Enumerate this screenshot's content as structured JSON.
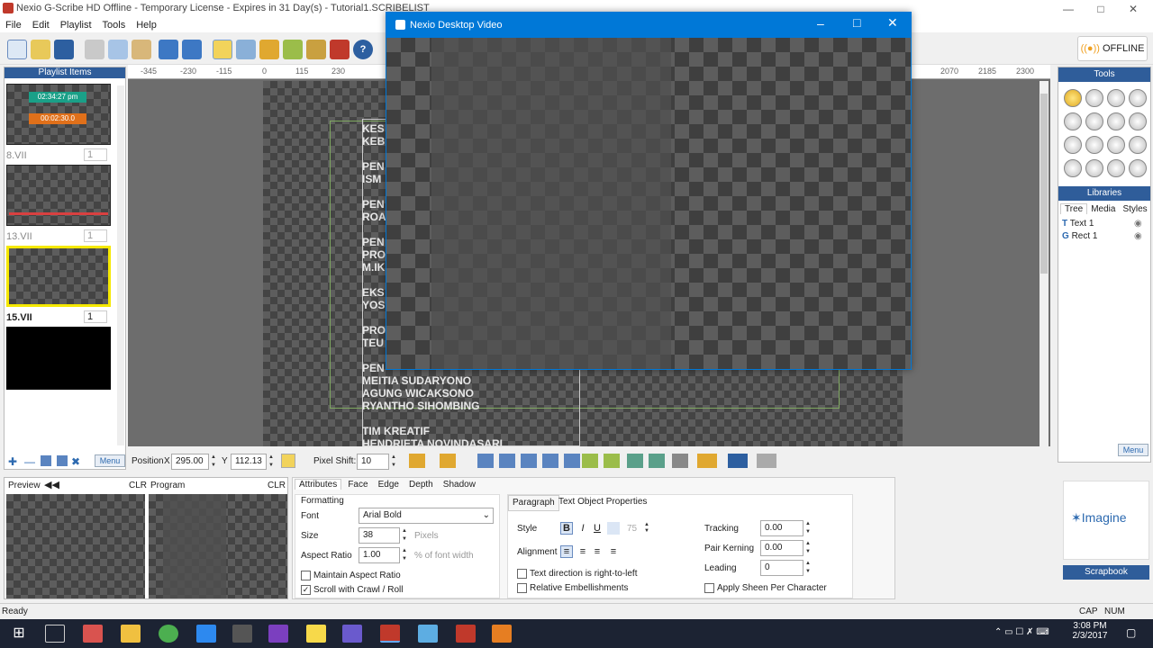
{
  "window": {
    "title": "Nexio G-Scribe HD Offline - Temporary License - Expires in 31 Day(s) - Tutorial1.SCRIBELIST"
  },
  "menu": [
    "File",
    "Edit",
    "Playlist",
    "Tools",
    "Help"
  ],
  "offline_label": "OFFLINE",
  "playlist": {
    "header": "Playlist Items",
    "items": [
      {
        "name": "8.VII",
        "count": "1",
        "time1": "02:34:27 pm",
        "time2": "00:02:30.0"
      },
      {
        "name": "13.VII",
        "count": "1"
      },
      {
        "name": "15.VII",
        "count": "1"
      }
    ],
    "menu_label": "Menu"
  },
  "ruler_ticks": [
    "-345",
    "-230",
    "-115",
    "0",
    "115",
    "230",
    "2070",
    "2185",
    "2300"
  ],
  "canvas_text": [
    "KES",
    "KEB",
    "PEN",
    "ISM",
    "PEN",
    "ROA",
    "PEN",
    "PRO",
    "M.IK",
    "EKS",
    "YOS",
    "PRO",
    "TEU",
    "PEN",
    "MEITIA SUDARYONO",
    "AGUNG WICAKSONO",
    "RYANTHO SIHOMBING",
    "TIM KREATIF",
    "HENDRIETA NOVINDASARI"
  ],
  "video_window": {
    "title": "Nexio Desktop Video"
  },
  "position": {
    "label": "Position",
    "x_label": "X",
    "x": "295.00",
    "y_label": "Y",
    "y": "112.13",
    "pixel_shift_label": "Pixel Shift:",
    "pixel_shift": "10"
  },
  "preview": {
    "preview_label": "Preview",
    "clr1": "CLR",
    "program_label": "Program",
    "clr2": "CLR"
  },
  "attr_tabs": [
    "Attributes",
    "Face",
    "Edge",
    "Depth",
    "Shadow"
  ],
  "formatting": {
    "label": "Formatting",
    "font_label": "Font",
    "font": "Arial Bold",
    "size_label": "Size",
    "size": "38",
    "size_unit": "Pixels",
    "aspect_label": "Aspect Ratio",
    "aspect": "1.00",
    "aspect_unit": "% of font width",
    "maintain_label": "Maintain Aspect Ratio",
    "scroll_label": "Scroll with Crawl / Roll"
  },
  "paragraph": {
    "tabs": [
      "Paragraph",
      "Text Object Properties"
    ],
    "style_label": "Style",
    "style_value": "75",
    "alignment_label": "Alignment",
    "tracking_label": "Tracking",
    "tracking": "0.00",
    "pair_kerning_label": "Pair Kerning",
    "pair_kerning": "0.00",
    "leading_label": "Leading",
    "leading": "0",
    "rtl_label": "Text direction is right-to-left",
    "relative_label": "Relative Embellishments",
    "sheen_label": "Apply Sheen Per Character"
  },
  "tools": {
    "header": "Tools",
    "libraries_header": "Libraries",
    "lib_tabs": [
      "Tree",
      "Media",
      "Styles"
    ],
    "tree": [
      "Text 1",
      "Rect 1"
    ],
    "menu_label": "Menu"
  },
  "brand": {
    "name": "Imagine",
    "scrapbook": "Scrapbook"
  },
  "status": {
    "text": "Ready",
    "cap": "CAP",
    "num": "NUM"
  },
  "taskbar": {
    "time": "3:08 PM",
    "date": "2/3/2017"
  }
}
